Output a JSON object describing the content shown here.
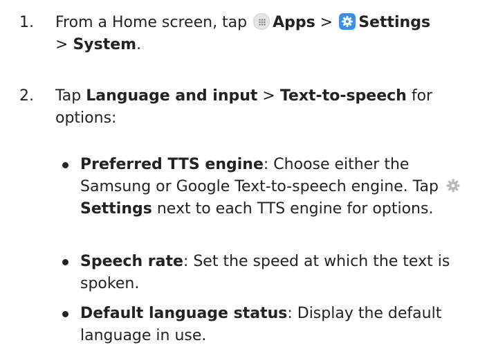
{
  "steps": [
    {
      "number": "1.",
      "t1": "From a Home screen, tap",
      "apps": "Apps",
      "sep1": ">",
      "settings": "Settings",
      "sep2": ">",
      "system": "System",
      "period": "."
    },
    {
      "number": "2.",
      "t1": "Tap",
      "lang": "Language and input",
      "sep": ">",
      "tts": "Text-to-speech",
      "t2": "for options:"
    }
  ],
  "options": [
    {
      "title": "Preferred TTS engine",
      "desc1": ": Choose either the Samsung or Google Text-to-speech engine. Tap",
      "settings": "Settings",
      "desc2": "next to each TTS engine for options."
    },
    {
      "title": "Speech rate",
      "desc": ": Set the speed at which the text is spoken."
    },
    {
      "title": "Default language status",
      "desc": ": Display the default language in use."
    }
  ],
  "icons": {
    "apps": "apps-grid-icon",
    "settings": "settings-gear-icon",
    "engine_settings": "gear-icon"
  },
  "colors": {
    "settings_icon_bg": "#3a8fe8",
    "gear_icon": "#b8b8b8"
  }
}
